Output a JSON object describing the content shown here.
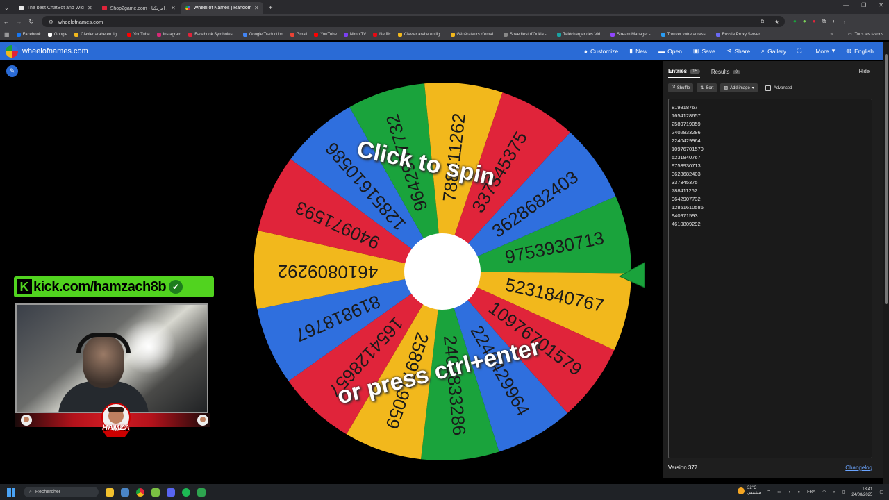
{
  "browser": {
    "tabs": [
      {
        "title": "The best ChatBot and Widgets",
        "active": false
      },
      {
        "title": "Shop2game.com - شحال أمريكيا",
        "active": false
      },
      {
        "title": "Wheel of Names | Random nam",
        "active": true
      }
    ],
    "new_tab": "+",
    "url": "wheelofnames.com",
    "bookmarks": [
      {
        "label": "Facebook",
        "color": "#1877f2"
      },
      {
        "label": "Google",
        "color": "#ffffff"
      },
      {
        "label": "Clavier arabe en lig...",
        "color": "#f2b81c"
      },
      {
        "label": "YouTube",
        "color": "#ff0000"
      },
      {
        "label": "Instagram",
        "color": "#d62976"
      },
      {
        "label": "Facebook Symboles...",
        "color": "#e0243a"
      },
      {
        "label": "Google Traduction",
        "color": "#4285f4"
      },
      {
        "label": "Gmail",
        "color": "#ea4335"
      },
      {
        "label": "YouTube",
        "color": "#ff0000"
      },
      {
        "label": "Nimo TV",
        "color": "#7b3ff2"
      },
      {
        "label": "Netflix",
        "color": "#e50914"
      },
      {
        "label": "Clavier arabe en lig...",
        "color": "#f2b81c"
      },
      {
        "label": "Générateurs d'emai...",
        "color": "#f2b81c"
      },
      {
        "label": "Speedtest d'Ookla -...",
        "color": "#888888"
      },
      {
        "label": "Télécharger des Vid...",
        "color": "#1aa3a3"
      },
      {
        "label": "Stream Manager -...",
        "color": "#9146ff"
      },
      {
        "label": "Trouver votre adress...",
        "color": "#2a9df4"
      },
      {
        "label": "Russia Proxy Server...",
        "color": "#6a6af4"
      }
    ],
    "all_bookmarks": "Tous les favoris"
  },
  "app": {
    "brand": "wheelofnames.com",
    "menu": [
      {
        "label": "Customize",
        "icon": "palette-icon",
        "glyph": "◕"
      },
      {
        "label": "New",
        "icon": "file-icon",
        "glyph": "▮"
      },
      {
        "label": "Open",
        "icon": "folder-icon",
        "glyph": "▬"
      },
      {
        "label": "Save",
        "icon": "save-icon",
        "glyph": "▣"
      },
      {
        "label": "Share",
        "icon": "share-icon",
        "glyph": "⋖"
      },
      {
        "label": "Gallery",
        "icon": "search-icon",
        "glyph": "⌕"
      },
      {
        "label": "",
        "icon": "fullscreen-icon",
        "glyph": "⛶"
      },
      {
        "label": "More",
        "icon": "chevron-down-icon",
        "glyph": "▾"
      },
      {
        "label": "English",
        "icon": "globe-icon",
        "glyph": "◍"
      }
    ]
  },
  "stream": {
    "kick_text": "kick.com/hamzach8b",
    "kick_glyph": "K",
    "verified_glyph": "✔",
    "logo_name": "HAMZA"
  },
  "wheel": {
    "cta_top": "Click to spin",
    "cta_bottom": "or press ctrl+enter",
    "colors": [
      "#f2b81c",
      "#e0243a",
      "#2f6fde",
      "#1aa33c"
    ],
    "pointer_color": "#1aa33c"
  },
  "panel": {
    "tab_entries": "Entries",
    "entries_count": "15",
    "tab_results": "Results",
    "results_count": "0",
    "hide": "Hide",
    "shuffle": "Shuffle",
    "sort": "Sort",
    "add_image": "Add image",
    "advanced": "Advanced",
    "entries": [
      "819818767",
      "1654128657",
      "2589719059",
      "2402833286",
      "2240429964",
      "10976701579",
      "5231840767",
      "9753930713",
      "3628682403",
      "337345375",
      "788411262",
      "9642907732",
      "12851610586",
      "940971593",
      "4610809292"
    ],
    "version": "Version 377",
    "changelog": "Changelog"
  },
  "taskbar": {
    "search": "Rechercher",
    "weather_temp": "32°C",
    "weather_desc": "مشمس",
    "lang": "FRA",
    "time": "13:41",
    "date": "24/08/2025"
  }
}
